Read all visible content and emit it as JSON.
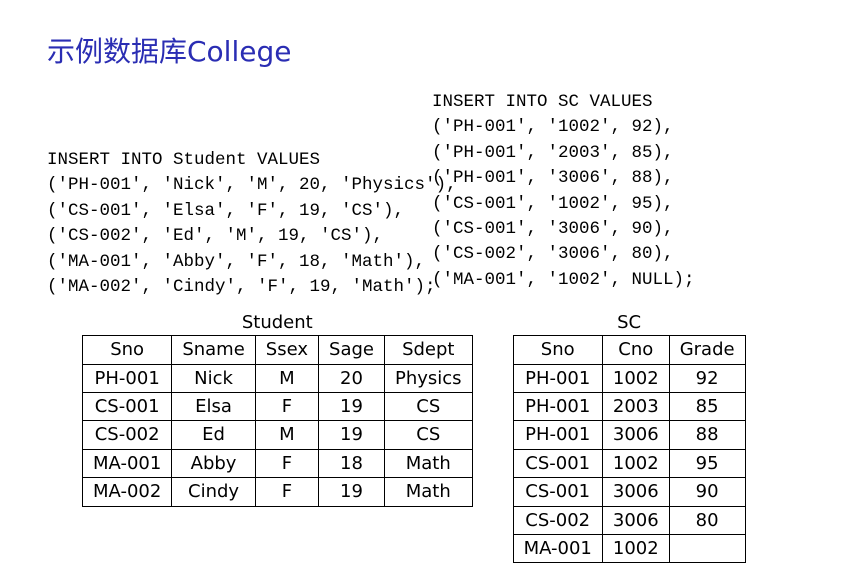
{
  "title": "示例数据库College",
  "code_blocks": {
    "student_insert": "INSERT INTO Student VALUES\n('PH-001', 'Nick', 'M', 20, 'Physics'),\n('CS-001', 'Elsa', 'F', 19, 'CS'),\n('CS-002', 'Ed', 'M', 19, 'CS'),\n('MA-001', 'Abby', 'F', 18, 'Math'),\n('MA-002', 'Cindy', 'F', 19, 'Math');",
    "sc_insert": "INSERT INTO SC VALUES\n('PH-001', '1002', 92),\n('PH-001', '2003', 85),\n('PH-001', '3006', 88),\n('CS-001', '1002', 95),\n('CS-001', '3006', 90),\n('CS-002', '3006', 80),\n('MA-001', '1002', NULL);"
  },
  "student_table": {
    "caption": "Student",
    "headers": [
      "Sno",
      "Sname",
      "Ssex",
      "Sage",
      "Sdept"
    ],
    "rows": [
      [
        "PH-001",
        "Nick",
        "M",
        "20",
        "Physics"
      ],
      [
        "CS-001",
        "Elsa",
        "F",
        "19",
        "CS"
      ],
      [
        "CS-002",
        "Ed",
        "M",
        "19",
        "CS"
      ],
      [
        "MA-001",
        "Abby",
        "F",
        "18",
        "Math"
      ],
      [
        "MA-002",
        "Cindy",
        "F",
        "19",
        "Math"
      ]
    ]
  },
  "sc_table": {
    "caption": "SC",
    "headers": [
      "Sno",
      "Cno",
      "Grade"
    ],
    "rows": [
      [
        "PH-001",
        "1002",
        "92"
      ],
      [
        "PH-001",
        "2003",
        "85"
      ],
      [
        "PH-001",
        "3006",
        "88"
      ],
      [
        "CS-001",
        "1002",
        "95"
      ],
      [
        "CS-001",
        "3006",
        "90"
      ],
      [
        "CS-002",
        "3006",
        "80"
      ],
      [
        "MA-001",
        "1002",
        ""
      ]
    ]
  }
}
